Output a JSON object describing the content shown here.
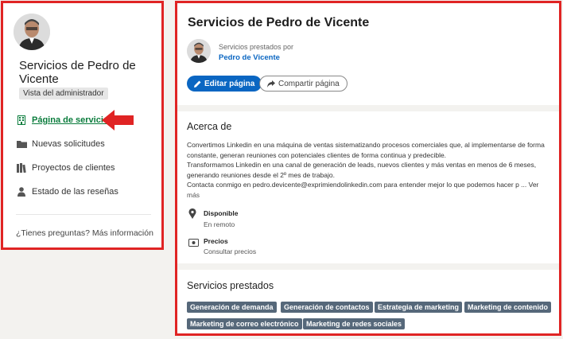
{
  "sidebar": {
    "title": "Servicios de Pedro de Vicente",
    "admin_badge": "Vista del administrador",
    "items": [
      {
        "label": "Página de servicios",
        "icon": "building-icon"
      },
      {
        "label": "Nuevas solicitudes",
        "icon": "folder-icon"
      },
      {
        "label": "Proyectos de clientes",
        "icon": "books-icon"
      },
      {
        "label": "Estado de las reseñas",
        "icon": "person-icon"
      }
    ],
    "help": "¿Tienes preguntas? Más información"
  },
  "main": {
    "title": "Servicios de Pedro de Vicente",
    "provided_by_label": "Servicios prestados por",
    "owner_name": "Pedro de Vicente",
    "edit_button": "Editar página",
    "share_button": "Compartir página",
    "about": {
      "heading": "Acerca de",
      "lines": [
        "Convertimos Linkedin en una máquina de ventas sistematizando procesos comerciales que, al implementarse de forma",
        "constante, generan reuniones con potenciales clientes de forma continua y predecible.",
        "Transformamos Linkedin en una canal de generación de leads, nuevos clientes y más ventas en menos de 6 meses,",
        "generando reuniones desde el 2º mes de trabajo.",
        "Contacta conmigo en pedro.devicente@exprimiendolinkedin.com para entender mejor lo que podemos hacer p ... Ver",
        "más"
      ]
    },
    "availability": {
      "title": "Disponible",
      "value": "En remoto",
      "icon": "location-pin-icon"
    },
    "pricing": {
      "title": "Precios",
      "value": "Consultar precios",
      "icon": "money-icon"
    },
    "services": {
      "heading": "Servicios prestados",
      "tags": [
        "Generación de demanda",
        "Generación de contactos",
        "Estrategia de marketing",
        "Marketing de contenido",
        "Marketing de correo electrónico",
        "Marketing de redes sociales"
      ]
    }
  },
  "colors": {
    "highlight_border": "#e02424",
    "primary_button": "#0a66c2",
    "active_nav": "#0a7c3c",
    "tag_background": "#56687a"
  }
}
